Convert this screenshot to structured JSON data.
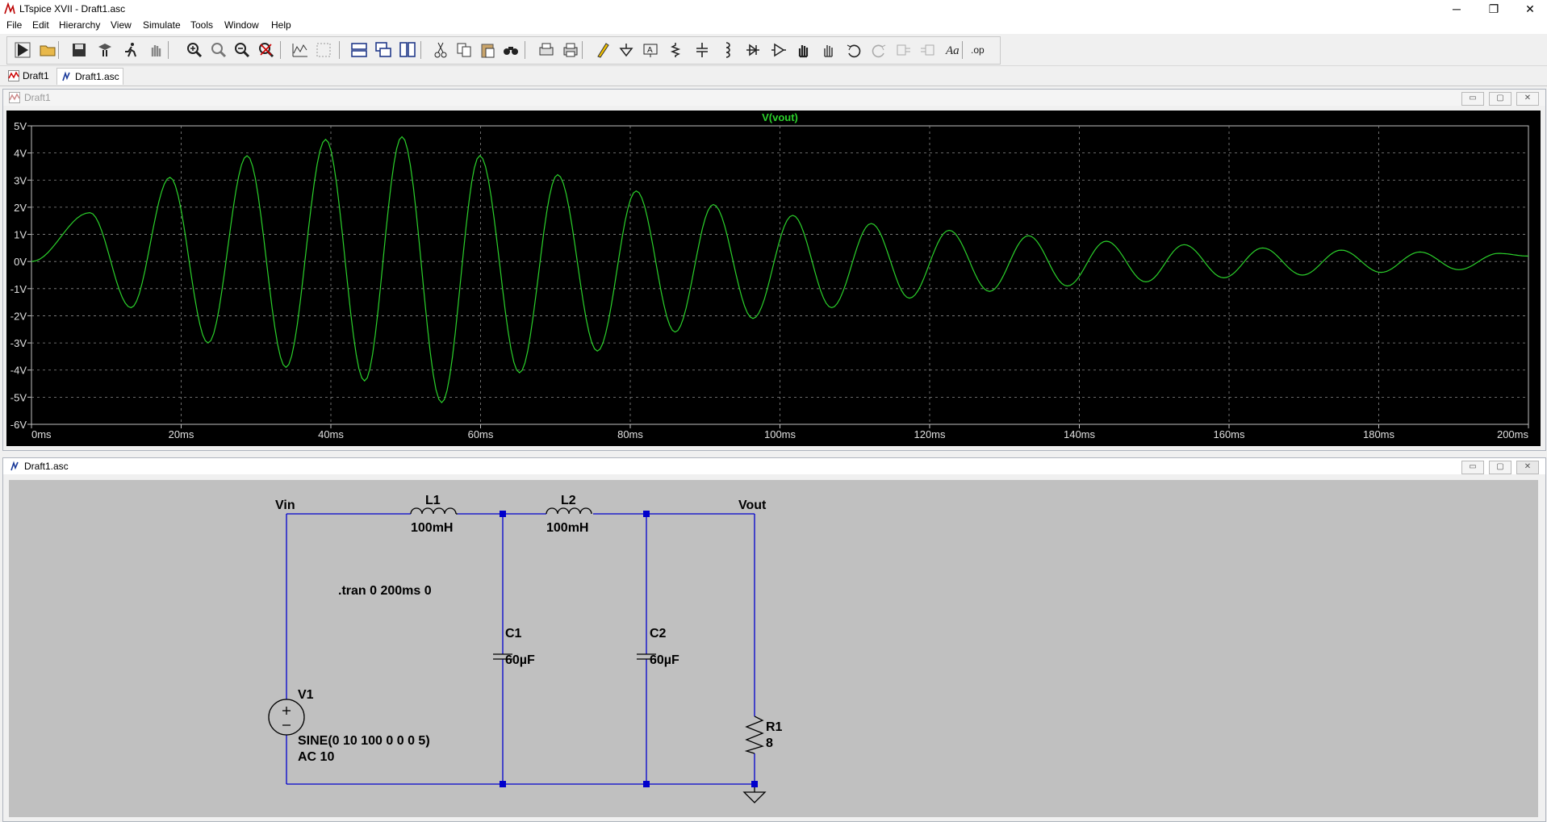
{
  "window": {
    "title": "LTspice XVII - Draft1.asc",
    "minimize": "─",
    "restore": "❐",
    "close": "✕"
  },
  "menu": [
    "File",
    "Edit",
    "Hierarchy",
    "View",
    "Simulate",
    "Tools",
    "Window",
    "Help"
  ],
  "toolbar": [
    "run-icon",
    "open-icon",
    "save-icon",
    "control-panel-icon",
    "run-man-icon",
    "pan-hand-icon",
    "zoom-in-icon",
    "zoom-full-icon",
    "zoom-out-icon",
    "zoom-cancel-icon",
    "autorange-icon",
    "grid-icon",
    "tile-horizontal-icon",
    "cascade-icon",
    "tile-vertical-icon",
    "cut-icon",
    "copy-icon",
    "paste-icon",
    "find-icon",
    "print-setup-icon",
    "print-icon",
    "wire-icon",
    "ground-icon",
    "label-net-icon",
    "resistor-icon",
    "capacitor-icon",
    "inductor-icon",
    "diode-icon",
    "component-icon",
    "move-icon",
    "drag-icon",
    "undo-icon",
    "redo-icon",
    "rotate-icon",
    "mirror-icon",
    "text-icon",
    "spice-directive-icon"
  ],
  "toolbar_text": "Aa",
  "toolbar_op": ".op",
  "tabs": [
    {
      "label": "Draft1"
    },
    {
      "label": "Draft1.asc"
    }
  ],
  "waveform_window": {
    "title": "Draft1",
    "min": "▭",
    "max": "▢",
    "close": "✕"
  },
  "schematic_window": {
    "title": "Draft1.asc",
    "min": "▭",
    "max": "▢",
    "close": "✕"
  },
  "chart_data": {
    "type": "line",
    "title": "V(vout)",
    "xlabel": "",
    "ylabel": "",
    "xlim": [
      0,
      200
    ],
    "ylim": [
      -6,
      5
    ],
    "x_ticks": [
      "0ms",
      "20ms",
      "40ms",
      "60ms",
      "80ms",
      "100ms",
      "120ms",
      "140ms",
      "160ms",
      "180ms",
      "200ms"
    ],
    "y_ticks": [
      "5V",
      "4V",
      "3V",
      "2V",
      "1V",
      "0V",
      "-1V",
      "-2V",
      "-3V",
      "-4V",
      "-5V",
      "-6V"
    ],
    "grid": true,
    "series": [
      {
        "name": "V(vout)",
        "color": "#2bd12b",
        "peaks_ms": [
          0,
          7.8,
          13.3,
          18.5,
          23.6,
          28.8,
          34.0,
          39.3,
          44.5,
          49.5,
          54.8,
          59.9,
          65.2,
          70.3,
          75.6,
          80.8,
          86.0,
          91.1,
          96.4,
          101.7,
          106.9,
          112.2,
          117.3,
          122.6,
          128.0,
          133.2,
          138.4,
          143.6,
          148.9,
          154.0,
          159.3,
          164.5,
          169.8,
          175.0,
          180.3,
          185.5,
          190.7,
          196.0,
          200.0
        ],
        "peaks_v": [
          0,
          1.8,
          -1.7,
          3.1,
          -3.0,
          3.9,
          -3.9,
          4.5,
          -4.4,
          4.6,
          -5.2,
          3.9,
          -4.1,
          3.2,
          -3.3,
          2.6,
          -2.6,
          2.1,
          -2.1,
          1.7,
          -1.7,
          1.4,
          -1.35,
          1.15,
          -1.1,
          0.95,
          -0.9,
          0.75,
          -0.75,
          0.62,
          -0.6,
          0.5,
          -0.5,
          0.42,
          -0.4,
          0.35,
          -0.3,
          0.3,
          0.2
        ]
      }
    ]
  },
  "schematic": {
    "labels": {
      "vin": "Vin",
      "vout": "Vout",
      "l1": "L1",
      "l1_value": "100mH",
      "l2": "L2",
      "l2_value": "100mH",
      "c1": "C1",
      "c1_value": "60µF",
      "c2": "C2",
      "c2_value": "60µF",
      "r1": "R1",
      "r1_value": "8",
      "v1": "V1",
      "v1_value": "SINE(0 10 100 0 0 0 5)",
      "v1_ac": "AC 10",
      "directive": ".tran 0 200ms 0"
    },
    "wire_color": "#0000cc"
  }
}
